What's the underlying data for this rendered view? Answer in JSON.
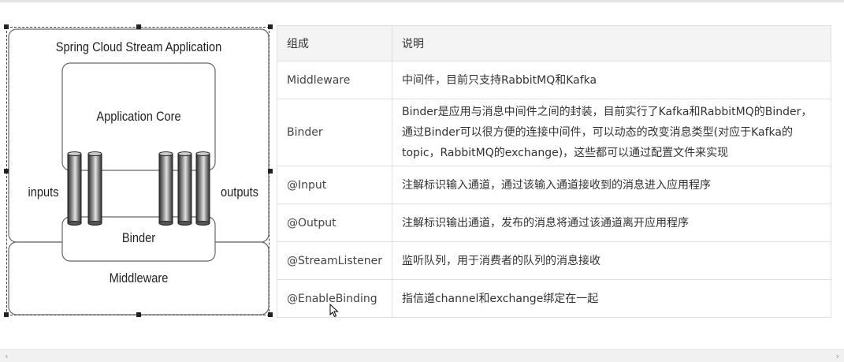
{
  "diagram": {
    "title": "Spring Cloud Stream Application",
    "core_label": "Application Core",
    "inputs_label": "inputs",
    "outputs_label": "outputs",
    "binder_label": "Binder",
    "middleware_label": "Middleware"
  },
  "table": {
    "headers": [
      "组成",
      "说明"
    ],
    "rows": [
      {
        "name": "Middleware",
        "desc": "中间件，目前只支持RabbitMQ和Kafka"
      },
      {
        "name": "Binder",
        "desc": "Binder是应用与消息中间件之间的封装，目前实行了Kafka和RabbitMQ的Binder，通过Binder可以很方便的连接中间件，可以动态的改变消息类型(对应于Kafka的topic，RabbitMQ的exchange)，这些都可以通过配置文件来实现"
      },
      {
        "name": "@Input",
        "desc": "注解标识输入通道，通过该输入通道接收到的消息进入应用程序"
      },
      {
        "name": "@Output",
        "desc": "注解标识输出通道，发布的消息将通过该通道离开应用程序"
      },
      {
        "name": "@StreamListener",
        "desc": "监听队列，用于消费者的队列的消息接收"
      },
      {
        "name": "@EnableBinding",
        "desc": "指信道channel和exchange绑定在一起"
      }
    ]
  },
  "icons": {
    "cursor": "mouse-pointer-icon",
    "scroll_left": "chevron-left-icon",
    "scroll_right": "chevron-right-icon"
  }
}
